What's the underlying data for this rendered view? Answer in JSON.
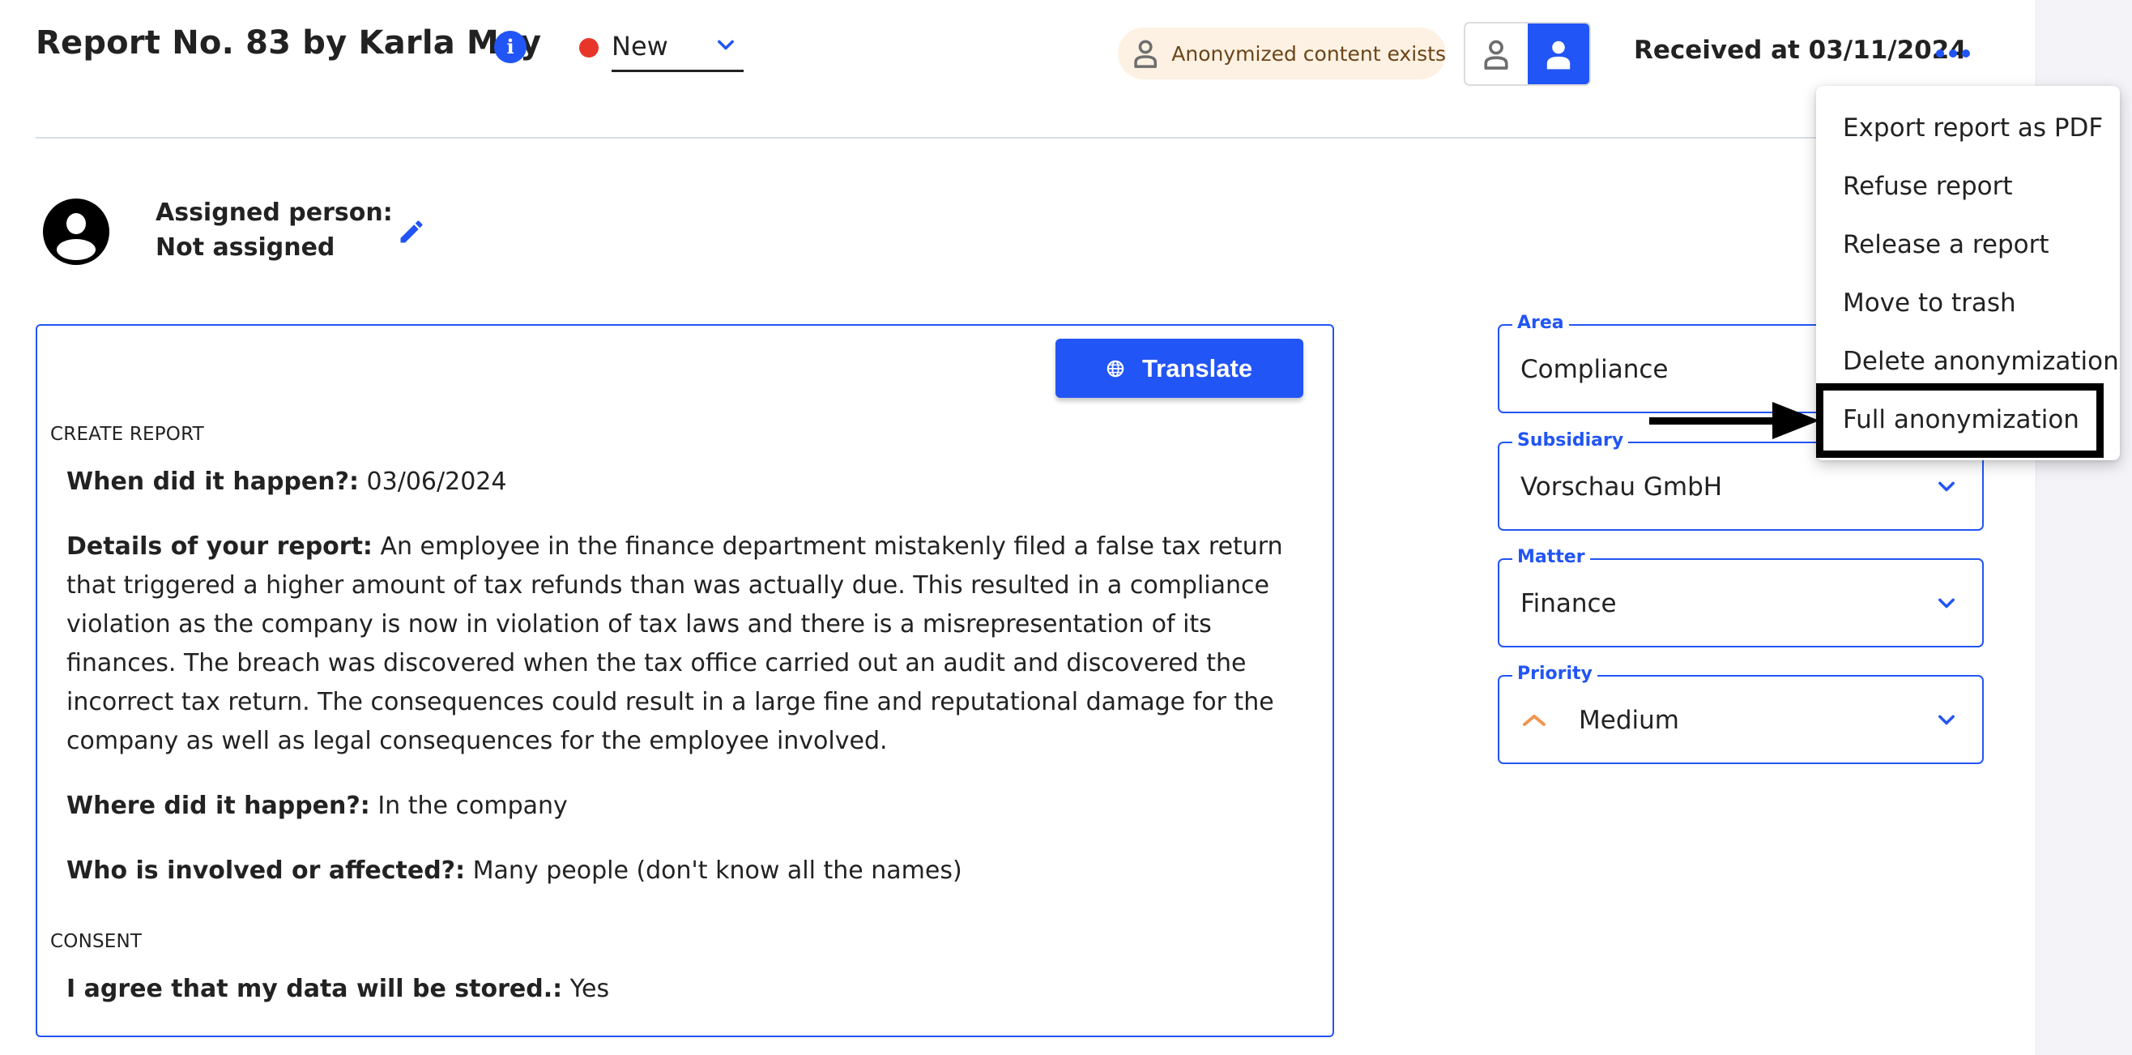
{
  "header": {
    "title": "Report No. 83 by Karla May",
    "info_icon": "info-icon",
    "status": {
      "value": "New",
      "color": "#e8352a"
    },
    "anonymized_badge": "Anonymized content exists",
    "view_toggle": {
      "options": [
        "anonymized-view",
        "original-view"
      ],
      "active": "original-view"
    },
    "received": "Received at 03/11/2024",
    "more_icon": "more-horizontal-icon"
  },
  "assignment": {
    "label": "Assigned person:",
    "value": "Not assigned"
  },
  "report": {
    "translate_label": "Translate",
    "sections": [
      {
        "title": "CREATE REPORT",
        "fields": [
          {
            "label": "When did it happen?:",
            "value": "03/06/2024"
          },
          {
            "label": "Details of your report:",
            "value": "An employee in the finance department mistakenly filed a false tax return that triggered a higher amount of tax refunds than was actually due. This resulted in a compliance violation as the company is now in violation of tax laws and there is a misrepresentation of its finances. The breach was discovered when the tax office carried out an audit and discovered the incorrect tax return. The consequences could result in a large fine and reputational damage for the company as well as legal consequences for the employee involved."
          },
          {
            "label": "Where did it happen?:",
            "value": "In the company"
          },
          {
            "label": "Who is involved or affected?:",
            "value": "Many people (don't know all the names)"
          }
        ]
      },
      {
        "title": "CONSENT",
        "fields": [
          {
            "label": "I agree that my data will be stored.:",
            "value": "Yes"
          }
        ]
      }
    ]
  },
  "properties": {
    "area": {
      "label": "Area",
      "value": "Compliance"
    },
    "subsidiary": {
      "label": "Subsidiary",
      "value": "Vorschau GmbH"
    },
    "matter": {
      "label": "Matter",
      "value": "Finance"
    },
    "priority": {
      "label": "Priority",
      "value": "Medium",
      "icon_color": "#f0964f"
    }
  },
  "menu": {
    "items": [
      "Export report as PDF",
      "Refuse report",
      "Release a report",
      "Move to trash",
      "Delete anonymization",
      "Full anonymization"
    ],
    "highlighted": "Full anonymization"
  },
  "colors": {
    "accent": "#2255f5",
    "status_new": "#e8352a",
    "badge_bg": "#fdf1e3",
    "badge_text": "#6b4518",
    "priority_medium": "#f0964f"
  }
}
